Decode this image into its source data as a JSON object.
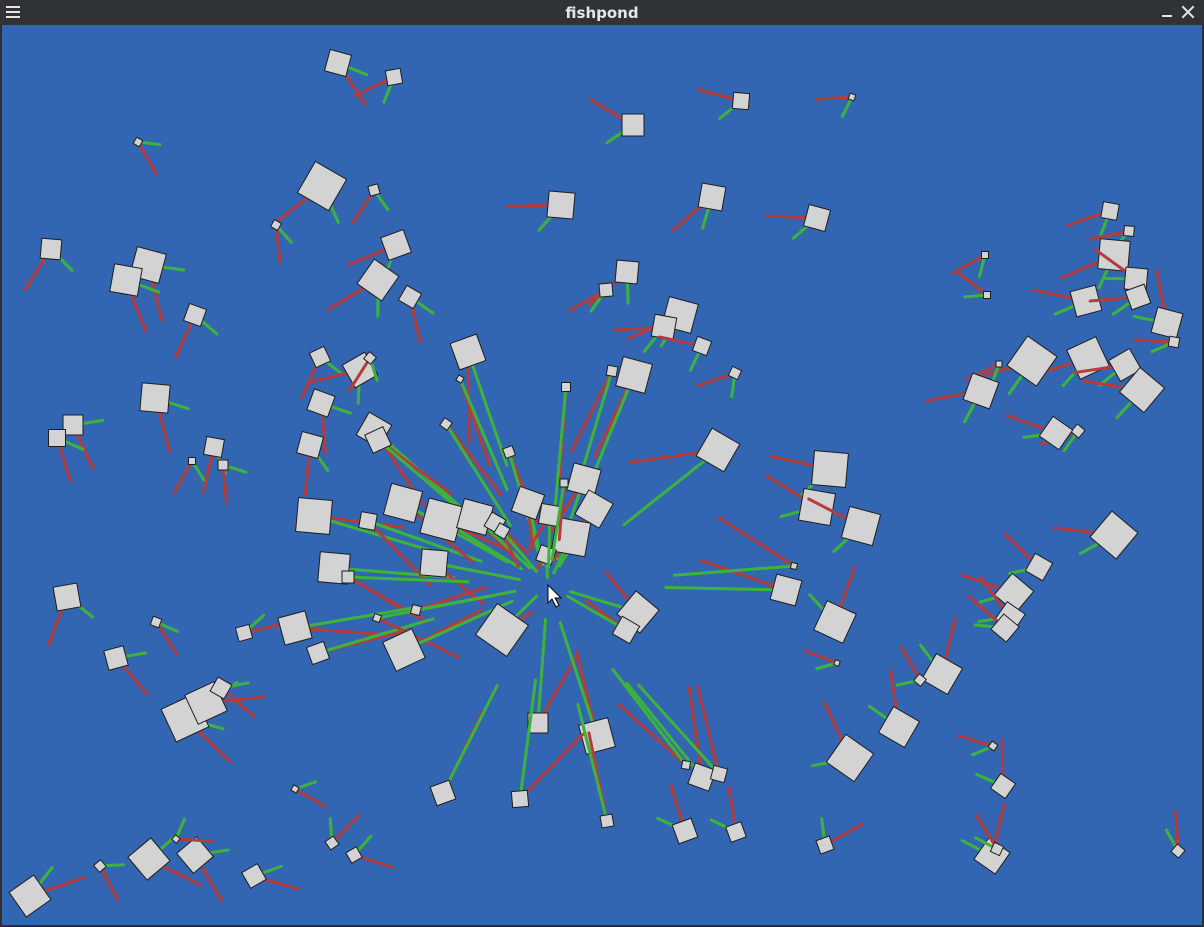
{
  "window": {
    "title": "fishpond"
  },
  "icons": {
    "menu": "hamburger-menu-icon",
    "minimize": "minimize-icon",
    "close": "close-icon",
    "cursor": "mouse-pointer-icon"
  },
  "colors": {
    "water": "#3366b2",
    "fish_fill": "#d3d3d3",
    "fish_stroke": "#1e1e1e",
    "green_vector": "#3cb43c",
    "red_vector": "#b43c3c",
    "titlebar": "#2f3237"
  }
}
